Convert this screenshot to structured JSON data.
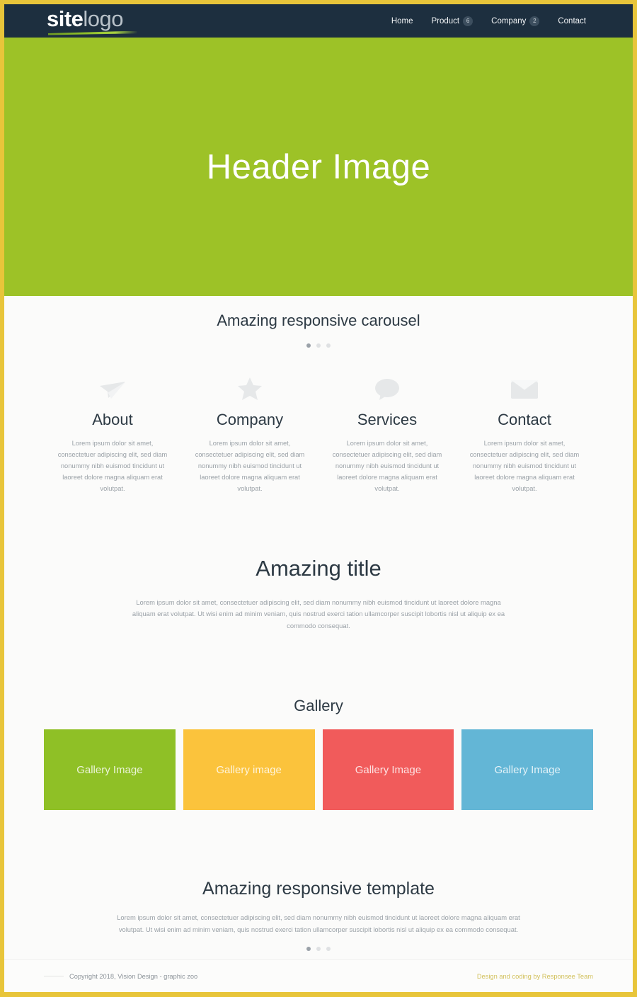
{
  "theme": {
    "frame_color": "#e8c53a",
    "navbar_bg": "#1d2f3f",
    "hero_bg": "#9dc227",
    "page_bg": "#fbfbfa",
    "heading_color": "#2d3a44",
    "muted_text": "#9aa1a7",
    "credit_color": "#d2c15c"
  },
  "navbar": {
    "logo": {
      "bold_part": "site",
      "light_part": "logo",
      "swoosh": "green-underline"
    },
    "menu": [
      {
        "label": "Home",
        "badge": null,
        "name": "nav-item-home"
      },
      {
        "label": "Product",
        "badge": "6",
        "name": "nav-item-product"
      },
      {
        "label": "Company",
        "badge": "2",
        "name": "nav-item-company"
      },
      {
        "label": "Contact",
        "badge": null,
        "name": "nav-item-contact"
      }
    ]
  },
  "hero": {
    "title": "Header Image"
  },
  "carousel": {
    "title": "Amazing responsive carousel",
    "dots": [
      {
        "active": true
      },
      {
        "active": false
      },
      {
        "active": false
      }
    ]
  },
  "features": {
    "body_text": "Lorem ipsum dolor sit amet, consectetuer adipiscing elit, sed diam nonummy nibh euismod tincidunt ut laoreet dolore magna aliquam erat volutpat.",
    "items": [
      {
        "title": "About",
        "icon": "paper-plane-icon",
        "text": "Lorem ipsum dolor sit amet, consectetuer adipiscing elit, sed diam nonummy nibh euismod tincidunt ut laoreet dolore magna aliquam erat volutpat."
      },
      {
        "title": "Company",
        "icon": "star-icon",
        "text": "Lorem ipsum dolor sit amet, consectetuer adipiscing elit, sed diam nonummy nibh euismod tincidunt ut laoreet dolore magna aliquam erat volutpat."
      },
      {
        "title": "Services",
        "icon": "speech-bubble-icon",
        "text": "Lorem ipsum dolor sit amet, consectetuer adipiscing elit, sed diam nonummy nibh euismod tincidunt ut laoreet dolore magna aliquam erat volutpat."
      },
      {
        "title": "Contact",
        "icon": "envelope-icon",
        "text": "Lorem ipsum dolor sit amet, consectetuer adipiscing elit, sed diam nonummy nibh euismod tincidunt ut laoreet dolore magna aliquam erat volutpat."
      }
    ]
  },
  "about": {
    "title": "Amazing title",
    "text": "Lorem ipsum dolor sit amet, consectetuer adipiscing elit, sed diam nonummy nibh euismod tincidunt ut laoreet dolore magna aliquam erat volutpat. Ut wisi enim ad minim veniam, quis nostrud exerci tation ullamcorper suscipit lobortis nisl ut aliquip ex ea commodo consequat."
  },
  "gallery": {
    "title": "Gallery",
    "tiles": [
      {
        "label": "Gallery Image",
        "color": "#8fc026"
      },
      {
        "label": "Gallery image",
        "color": "#fbc33c"
      },
      {
        "label": "Gallery Image",
        "color": "#f15b5b"
      },
      {
        "label": "Gallery Image",
        "color": "#63b6d6"
      }
    ]
  },
  "template": {
    "title": "Amazing responsive template",
    "text": "Lorem ipsum dolor sit amet, consectetuer adipiscing elit, sed diam nonummy nibh euismod tincidunt ut laoreet dolore magna aliquam erat volutpat. Ut wisi enim ad minim veniam, quis nostrud exerci tation ullamcorper suscipit lobortis nisl ut aliquip ex ea commodo consequat.",
    "dots": [
      {
        "active": true
      },
      {
        "active": false
      },
      {
        "active": false
      }
    ]
  },
  "footer": {
    "copyright": "Copyright 2018, Vision Design - graphic zoo",
    "credit": "Design and coding by Responsee Team"
  }
}
